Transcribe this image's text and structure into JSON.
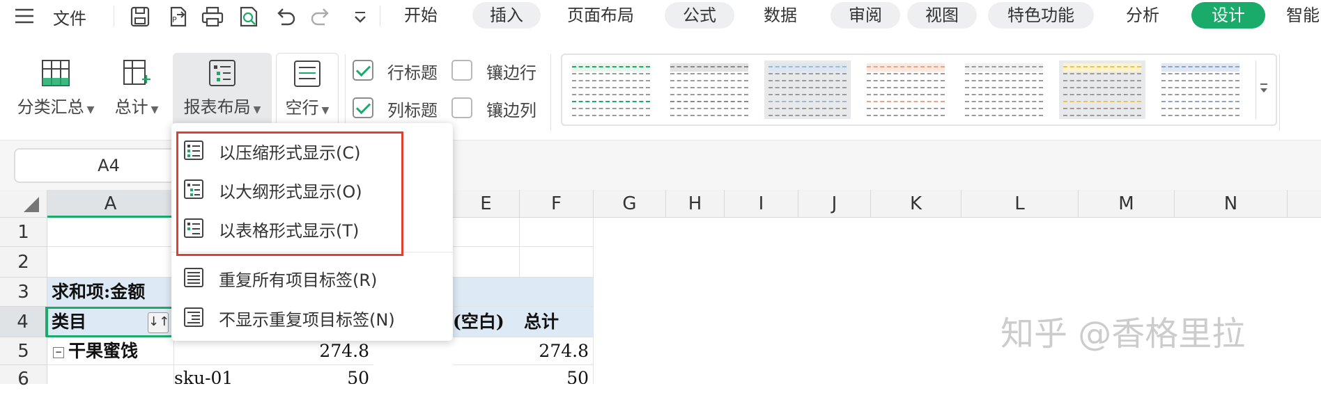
{
  "menubar": {
    "hamburger_icon": "menu-icon",
    "file_label": "文件",
    "quick_icons": [
      "save-icon",
      "export-pdf-icon",
      "print-icon",
      "print-preview-icon",
      "undo-icon",
      "redo-icon",
      "more-chevron-icon"
    ],
    "tabs": [
      {
        "label": "开始",
        "state": "plain"
      },
      {
        "label": "插入",
        "state": "pill"
      },
      {
        "label": "页面布局",
        "state": "plain"
      },
      {
        "label": "公式",
        "state": "pill"
      },
      {
        "label": "数据",
        "state": "plain"
      },
      {
        "label": "审阅",
        "state": "pill"
      },
      {
        "label": "视图",
        "state": "pill"
      },
      {
        "label": "特色功能",
        "state": "pill"
      },
      {
        "label": "分析",
        "state": "plain"
      },
      {
        "label": "设计",
        "state": "active"
      },
      {
        "label": "智能",
        "state": "plain"
      }
    ]
  },
  "ribbon": {
    "subtotal": "分类汇总",
    "grand_total": "总计",
    "report_layout": "报表布局",
    "blank_rows": "空行",
    "row_headers": {
      "label": "行标题",
      "checked": true
    },
    "banded_rows": {
      "label": "镶边行",
      "checked": false
    },
    "col_headers": {
      "label": "列标题",
      "checked": true
    },
    "banded_cols": {
      "label": "镶边列",
      "checked": false
    },
    "style_colors": [
      "#1aab6a",
      "#888888",
      "#9fb7cf",
      "#e8a484",
      "#9a9a9a",
      "#e8c457",
      "#8aa3c8"
    ]
  },
  "formula_bar": {
    "name_box": "A4"
  },
  "grid": {
    "columns": [
      "A",
      "E",
      "F",
      "G",
      "H",
      "I",
      "J",
      "K",
      "L",
      "M",
      "N"
    ],
    "rows": [
      "1",
      "2",
      "3",
      "4",
      "5",
      "6"
    ],
    "cells": {
      "a3": "求和项:金额",
      "a4": "类目",
      "e4": "(空白)",
      "f4": "总计",
      "a5": "干果蜜饯",
      "d5": "274.8",
      "f5": "274.8",
      "b6": "sku-01",
      "d6": "50",
      "f6": "50"
    },
    "collapse_symbol": "⊟"
  },
  "dropdown": {
    "items": [
      {
        "label": "以压缩形式显示(C)",
        "icon": "compact-layout-icon"
      },
      {
        "label": "以大纲形式显示(O)",
        "icon": "outline-layout-icon"
      },
      {
        "label": "以表格形式显示(T)",
        "icon": "tabular-layout-icon"
      },
      {
        "label": "重复所有项目标签(R)",
        "icon": "repeat-labels-icon"
      },
      {
        "label": "不显示重复项目标签(N)",
        "icon": "no-repeat-labels-icon"
      }
    ]
  },
  "watermark": "知乎 @香格里拉",
  "colors": {
    "accent": "#1aab6a",
    "highlight_box": "#e0402e",
    "pivot_header_bg": "#dde9f4"
  }
}
